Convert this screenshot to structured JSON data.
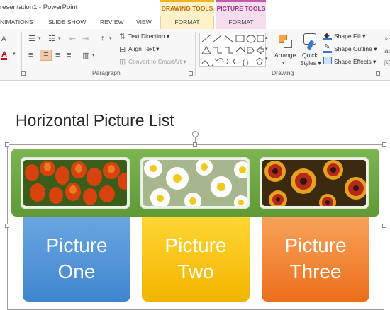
{
  "window": {
    "title": "resentation1 - PowerPoint"
  },
  "context_tabs": {
    "drawing_tools": "DRAWING TOOLS",
    "picture_tools": "PICTURE TOOLS"
  },
  "tabs": [
    {
      "label": "NIMATIONS"
    },
    {
      "label": "SLIDE SHOW"
    },
    {
      "label": "REVIEW"
    },
    {
      "label": "VIEW"
    },
    {
      "label": "FORMAT"
    },
    {
      "label": "FORMAT"
    }
  ],
  "ribbon": {
    "paragraph": {
      "label": "Paragraph",
      "text_direction": "Text Direction",
      "align_text": "Align Text",
      "convert_smartart": "Convert to SmartArt"
    },
    "drawing": {
      "label": "Drawing",
      "arrange": "Arrange",
      "quick_styles_1": "Quick",
      "quick_styles_2": "Styles",
      "shape_fill": "Shape Fill",
      "shape_outline": "Shape Outline",
      "shape_effects": "Shape Effects"
    }
  },
  "slide": {
    "title": "Horizontal Picture List",
    "cards": [
      {
        "line1": "Picture",
        "line2": "One",
        "color": "#4a8fd6"
      },
      {
        "line1": "Picture",
        "line2": "Two",
        "color": "#f7c200"
      },
      {
        "line1": "Picture",
        "line2": "Three",
        "color": "#ef7a28"
      }
    ],
    "band_color": "#6ca642"
  }
}
